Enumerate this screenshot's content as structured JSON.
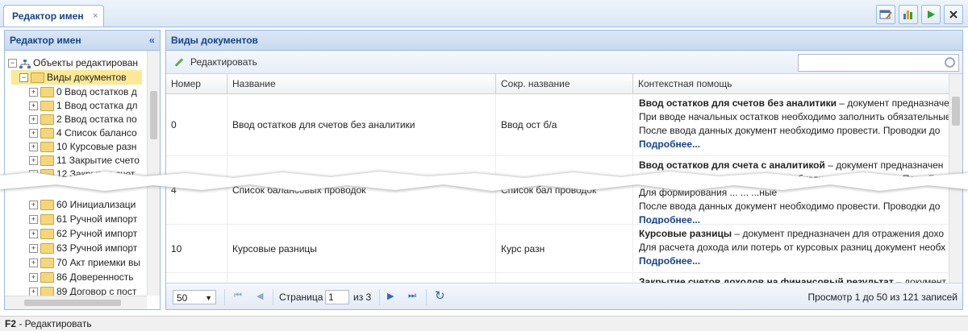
{
  "tab": {
    "title": "Редактор имен",
    "close": "×"
  },
  "left_panel": {
    "title": "Редактор имен",
    "collapse_glyph": "«",
    "tree": {
      "root": "Объекты редактирован",
      "selected": "Виды документов",
      "items_top": [
        "0 Ввод остатков д",
        "1 Ввод остатка дл",
        "2 Ввод остатка по",
        "4 Список балансо",
        "10 Курсовые разн",
        "11 Закрытие счето",
        "12 Закрытие счет"
      ],
      "items_bottom": [
        "60 Инициализаци",
        "61 Ручной импорт",
        "62 Ручной импорт",
        "63 Ручной импорт",
        "70 Акт приемки вы",
        "86 Доверенность",
        "89 Договор с пост"
      ]
    }
  },
  "right_panel": {
    "title": "Виды документов",
    "edit_label": "Редактировать",
    "search_placeholder": "",
    "columns": [
      "Номер",
      "Название",
      "Сокр. название",
      "Контекстная помощь"
    ],
    "rows": [
      {
        "num": "0",
        "name": "Ввод остатков для счетов без аналитики",
        "short": "Ввод ост б/а",
        "help_bold": "Ввод остатков для счетов без аналитики",
        "help_rest": " – документ предназначен",
        "help_lines": [
          "При вводе начальных остатков необходимо заполнить обязательные",
          "После ввода данных документ необходимо провести. Проводки до"
        ],
        "more": "Подробнее..."
      },
      {
        "num": "4",
        "name": "Список балансовых проводок",
        "short": "Список бал проводок",
        "help_bold": "Ввод остатков для счета с аналитикой",
        "help_rest": " – документ предназначен",
        "help_lines": [
          "При вводе начальных остатков необходимо выбрать счет. Поле Ба",
          "Для формирования ... ... ...ные"
        ],
        "help_lines2": [
          "После ввода данных документ необходимо провести. Проводки до"
        ],
        "more": "Подробнее..."
      },
      {
        "num": "10",
        "name": "Курсовые разницы",
        "short": "Курс разн",
        "help_bold": "Курсовые разницы",
        "help_rest": " – документ предназначен для отражения дохо",
        "help_lines": [
          "Для расчета дохода или потерь от курсовых разниц документ необх"
        ],
        "more": "Подробнее..."
      },
      {
        "num": "",
        "name": "",
        "short": "",
        "help_bold": "Закрытие счетов доходов на финансовый результат",
        "help_rest": " – документ",
        "help_lines": [],
        "more": ""
      }
    ],
    "pager": {
      "page_size": "50",
      "page_label": "Страница",
      "page_value": "1",
      "of_label": "из 3",
      "status": "Просмотр 1 до 50 из 121 записей"
    }
  },
  "statusbar": {
    "key": "F2",
    "text": " - Редактировать"
  },
  "icons": {
    "toolbar": [
      "report-edit-icon",
      "chart-icon",
      "play-icon",
      "close-icon"
    ],
    "accent": "#15428b",
    "border": "#99bbe8"
  }
}
